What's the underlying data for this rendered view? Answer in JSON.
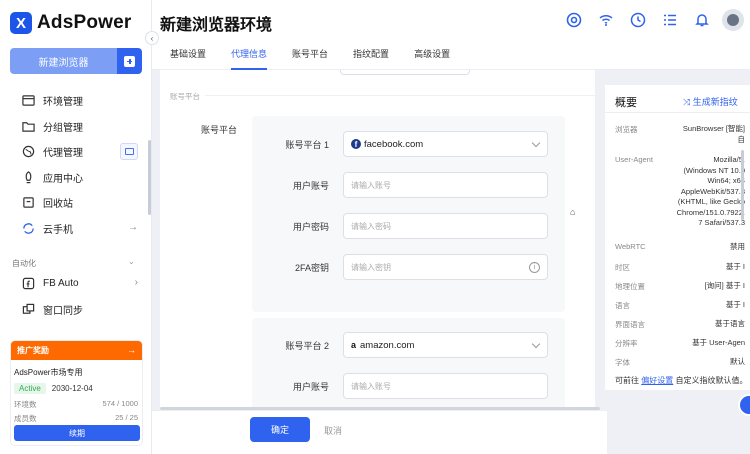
{
  "app": {
    "logo_mark": "X",
    "logo_text": "AdsPower",
    "page_title": "新建浏览器环境"
  },
  "sidebar": {
    "new_button": "新建浏览器",
    "items": [
      {
        "label": "环境管理",
        "icon": "browser-window-icon"
      },
      {
        "label": "分组管理",
        "icon": "folder-icon"
      },
      {
        "label": "代理管理",
        "icon": "globe-icon"
      },
      {
        "label": "应用中心",
        "icon": "rocket-icon"
      },
      {
        "label": "回收站",
        "icon": "trash-icon"
      },
      {
        "label": "云手机",
        "icon": "refresh-icon",
        "extra": "→"
      }
    ],
    "section": "自动化",
    "section_chevron": "⌄",
    "items2": [
      {
        "label": "FB Auto",
        "icon": "facebook-auto-icon",
        "extra": "›"
      },
      {
        "label": "窗口同步",
        "icon": "window-sync-icon"
      }
    ],
    "collapse": "‹"
  },
  "promo": {
    "header": "推广奖励",
    "arrow": "→",
    "title": "AdsPower市场专用",
    "status": "Active",
    "date": "2030-12-04",
    "env_label": "环境数",
    "env_value": "574 / 1000",
    "member_label": "成员数",
    "member_value": "25 / 25",
    "renew": "续期"
  },
  "header_icons": [
    "tiktok-icon",
    "wifi-icon",
    "clock-icon",
    "checklist-icon",
    "bell-icon",
    "avatar-icon"
  ],
  "tabs": [
    {
      "label": "基础设置",
      "active": false
    },
    {
      "label": "代理信息",
      "active": true
    },
    {
      "label": "账号平台",
      "active": false
    },
    {
      "label": "指纹配置",
      "active": false
    },
    {
      "label": "高级设置",
      "active": false
    }
  ],
  "form": {
    "section_faded": "账号平台",
    "group_label": "账号平台",
    "platform1": {
      "label": "账号平台 1",
      "value": "facebook.com",
      "user_label": "用户账号",
      "user_placeholder": "请输入账号",
      "pass_label": "用户密码",
      "pass_placeholder": "请输入密码",
      "twofa_label": "2FA密钥",
      "twofa_placeholder": "请输入密钥"
    },
    "platform2": {
      "label": "账号平台 2",
      "value": "amazon.com",
      "user_label": "用户账号",
      "user_placeholder": "请输入账号"
    }
  },
  "footer": {
    "confirm": "确定",
    "cancel": "取消"
  },
  "summary": {
    "title": "概要",
    "new_fp": "生成新指纹",
    "rows": [
      {
        "key": "浏览器",
        "value": "SunBrowser [智能]\n自"
      },
      {
        "key": "User-Agent",
        "value": "Mozilla/5.\n(Windows NT 10.0\nWin64; x64\nAppleWebKit/537.3\n(KHTML, like Gecko\nChrome/151.0.7922.\n7 Safari/537.3"
      },
      {
        "key": "WebRTC",
        "value": "禁用"
      },
      {
        "key": "时区",
        "value": "基于 I"
      },
      {
        "key": "地理位置",
        "value": "[询问] 基于 I"
      },
      {
        "key": "语言",
        "value": "基于 I"
      },
      {
        "key": "界面语言",
        "value": "基于语言"
      },
      {
        "key": "分辨率",
        "value": "基于 User-Agen"
      },
      {
        "key": "字体",
        "value": "默认"
      }
    ],
    "note_prefix": "可前往",
    "note_link": "偏好设置",
    "note_suffix": "自定义指纹默认值。"
  }
}
